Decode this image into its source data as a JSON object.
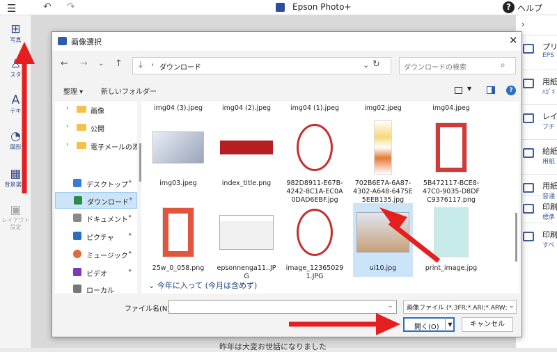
{
  "app": {
    "title": "Epson Photo+",
    "help_label": "ヘルプ"
  },
  "leftbar": {
    "photo": "写真",
    "stamp": "スタ",
    "text": "テキ",
    "shape": "図形",
    "bg": "背景選択",
    "layout": "レイアウト設定"
  },
  "rightbar": {
    "items": [
      {
        "title": "プリ",
        "sub": "EPS"
      },
      {
        "title": "用紙",
        "sub": "ﾊｶﾞｷ"
      },
      {
        "title": "レイ",
        "sub": "フチ"
      },
      {
        "title": "給紙",
        "sub": "用紙"
      },
      {
        "title": "用紙",
        "sub": "普通"
      },
      {
        "title": "印刷",
        "sub": "標準"
      },
      {
        "title": "印刷",
        "sub": "すべ"
      }
    ]
  },
  "canvas_text": "昨年は大変お世話になりました",
  "dialog": {
    "title": "画像選択",
    "address": {
      "path": "ダウンロード"
    },
    "search_placeholder": "ダウンロードの検索",
    "organize": "整理 ▾",
    "new_folder": "新しいフォルダー",
    "nav_folders": [
      {
        "label": "画像"
      },
      {
        "label": "公開"
      },
      {
        "label": "電子メールの添付"
      }
    ],
    "nav_quick": [
      {
        "label": "デスクトップ",
        "color": "#3a7bd5"
      },
      {
        "label": "ダウンロード",
        "color": "#2d8a4a"
      },
      {
        "label": "ドキュメント",
        "color": "#888888"
      },
      {
        "label": "ピクチャ",
        "color": "#2b6fbf"
      },
      {
        "label": "ミュージック",
        "color": "#e06a3a"
      },
      {
        "label": "ビデオ",
        "color": "#7a3ab8"
      },
      {
        "label": "ローカル",
        "color": "#777777"
      }
    ],
    "files_row0": [
      "img04 (3).jpeg",
      "img04 (2).jpeg",
      "img04 (1).jpeg",
      "img02.jpeg",
      "img04.jpeg"
    ],
    "files_row1": [
      "img03.jpeg",
      "index_title.png",
      "982D8911-E67B-4242-8C1A-EC0A0DAD6EBF.jpg",
      "702B6E7A-6A87-4302-A648-6475E5EEB135.jpg",
      "5B472117-BCE8-47C0-9035-D8DFC9376117.png"
    ],
    "files_row2": [
      "25w_0_058.png",
      "epsonnenga11..JPG",
      "image_123650291.JPG",
      "ui10.jpg",
      "print_image.jpg"
    ],
    "group_label": "今年に入って (今月は含めず)",
    "filename_label": "ファイル名(N):",
    "filename_value": "",
    "filetype_value": "画像ファイル (*.3FR;*.ARI;*.ARW;*",
    "open_label": "開く(O)",
    "cancel_label": "キャンセル"
  }
}
